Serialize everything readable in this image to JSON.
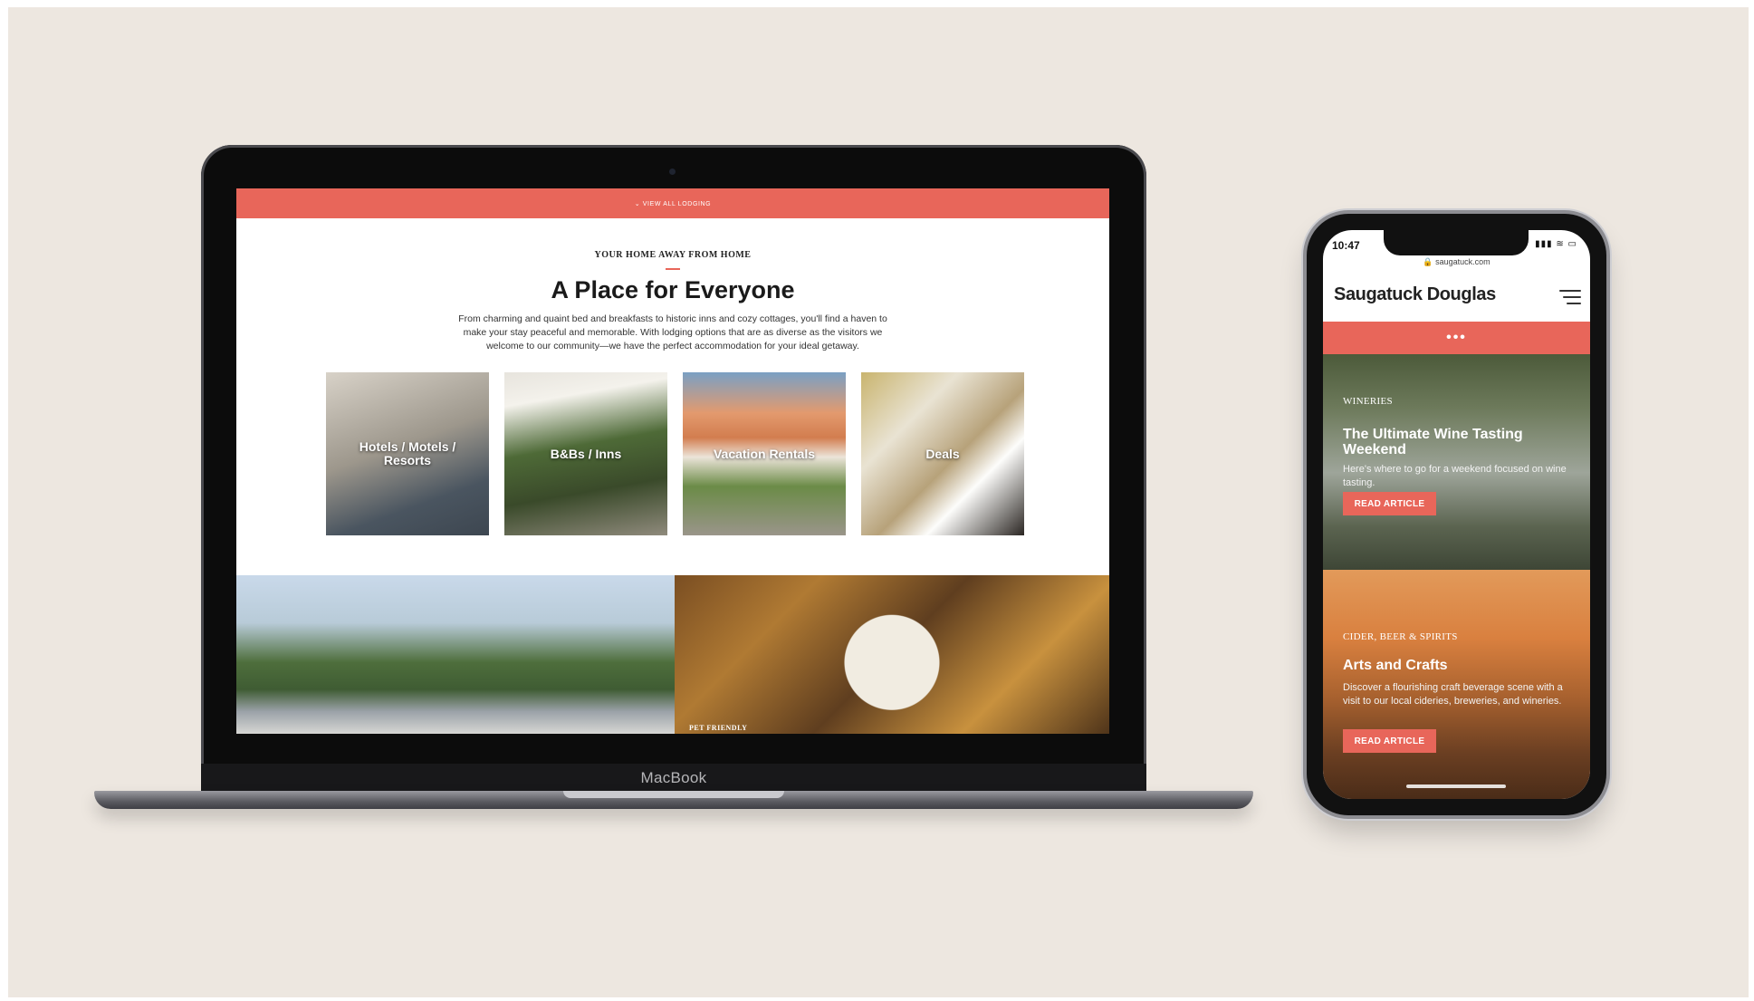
{
  "laptop": {
    "brand": "MacBook",
    "top_bar": "⌄ VIEW ALL LODGING",
    "eyebrow": "YOUR HOME AWAY FROM HOME",
    "headline": "A Place for Everyone",
    "intro": "From charming and quaint bed and breakfasts to historic inns and cozy cottages, you'll find a haven to make your stay peaceful and memorable. With lodging options that are as diverse as the visitors we welcome to our community—we have the perfect accommodation for your ideal getaway.",
    "tiles": [
      {
        "label": "Hotels / Motels / Resorts"
      },
      {
        "label": "B&Bs / Inns"
      },
      {
        "label": "Vacation Rentals"
      },
      {
        "label": "Deals"
      }
    ],
    "bottom_right_label": "PET FRIENDLY"
  },
  "phone": {
    "time": "10:47",
    "status_icons": "▮▮▮ ≋ ▭",
    "url": "🔒 saugatuck.com",
    "title": "Saugatuck Douglas",
    "dots": "•••",
    "cards": [
      {
        "category": "WINERIES",
        "title": "The Ultimate Wine Tasting Weekend",
        "description": "Here's where to go for a weekend focused on wine tasting.",
        "button": "READ ARTICLE"
      },
      {
        "category": "CIDER, BEER & SPIRITS",
        "title": "Arts and Crafts",
        "description": "Discover a flourishing craft beverage scene with a visit to our local cideries, breweries, and wineries.",
        "button": "READ ARTICLE"
      }
    ]
  },
  "colors": {
    "accent": "#e8665a",
    "backdrop": "#ede7e0"
  }
}
